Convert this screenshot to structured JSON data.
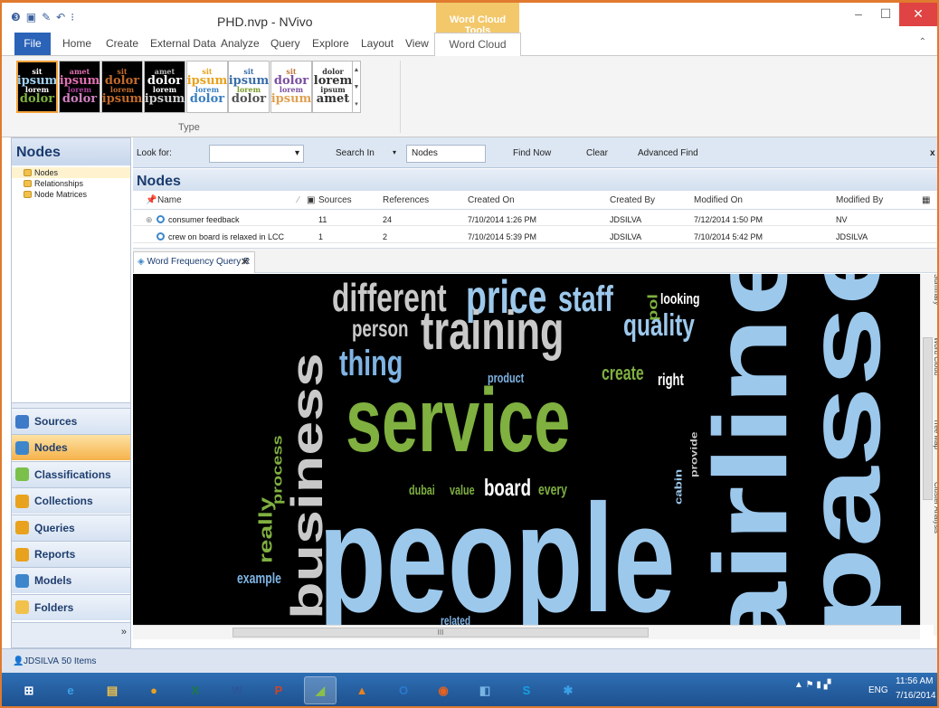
{
  "window": {
    "title": "PHD.nvp - NVivo",
    "context_tab_group": "Word Cloud Tools",
    "controls": {
      "minimize": "–",
      "maximize": "☐",
      "close": "✕"
    }
  },
  "qat_icons": [
    "nvivo-logo-icon",
    "save-icon",
    "edit-icon",
    "undo-icon",
    "customize-icon"
  ],
  "ribbon_tabs": [
    "File",
    "Home",
    "Create",
    "External Data",
    "Analyze",
    "Query",
    "Explore",
    "Layout",
    "View",
    "Word Cloud"
  ],
  "ribbon": {
    "group_label": "Type",
    "thumbs": [
      {
        "bg": "#000000",
        "words": [
          "sit",
          "ipsum",
          "lorem",
          "dolor"
        ],
        "colors": [
          "#ffffff",
          "#9fd0f0",
          "#ffffff",
          "#7fb040"
        ]
      },
      {
        "bg": "#000000",
        "words": [
          "amet",
          "ipsum",
          "lorem",
          "dolor"
        ],
        "colors": [
          "#e06fb0",
          "#e06fb0",
          "#b040a0",
          "#d080c0"
        ]
      },
      {
        "bg": "#000000",
        "words": [
          "sit",
          "dolor",
          "lorem",
          "ipsum"
        ],
        "colors": [
          "#c26a2a",
          "#c26a2a",
          "#c26a2a",
          "#c26a2a"
        ]
      },
      {
        "bg": "#000000",
        "words": [
          "amet",
          "dolor",
          "lorem",
          "ipsum"
        ],
        "colors": [
          "#bbbbbb",
          "#ffffff",
          "#ffffff",
          "#cccccc"
        ]
      },
      {
        "bg": "#ffffff",
        "words": [
          "sit",
          "ipsum",
          "lorem",
          "dolor"
        ],
        "colors": [
          "#e8a21e",
          "#e8a21e",
          "#3a7fc0",
          "#3a7fc0"
        ]
      },
      {
        "bg": "#ffffff",
        "words": [
          "sit",
          "ipsum",
          "lorem",
          "dolor"
        ],
        "colors": [
          "#3a6ea8",
          "#3a6ea8",
          "#7a9a2a",
          "#555555"
        ]
      },
      {
        "bg": "#ffffff",
        "words": [
          "sit",
          "dolor",
          "lorem",
          "ipsum"
        ],
        "colors": [
          "#c07a3a",
          "#7a4fa0",
          "#7a4fa0",
          "#e0a050"
        ]
      },
      {
        "bg": "#ffffff",
        "words": [
          "dolor",
          "lorem",
          "ipsum",
          "amet"
        ],
        "colors": [
          "#333333",
          "#333333",
          "#333333",
          "#333333"
        ]
      }
    ]
  },
  "nav": {
    "header": "Nodes",
    "tree": [
      "Nodes",
      "Relationships",
      "Node Matrices"
    ],
    "buttons": [
      {
        "label": "Sources",
        "icon": "sources-icon",
        "color": "#3d7ac8"
      },
      {
        "label": "Nodes",
        "icon": "nodes-icon",
        "color": "#3d86cc"
      },
      {
        "label": "Classifications",
        "icon": "classifications-icon",
        "color": "#7ac04a"
      },
      {
        "label": "Collections",
        "icon": "collections-icon",
        "color": "#e8a21e"
      },
      {
        "label": "Queries",
        "icon": "queries-icon",
        "color": "#e8a21e"
      },
      {
        "label": "Reports",
        "icon": "reports-icon",
        "color": "#e8a21e"
      },
      {
        "label": "Models",
        "icon": "models-icon",
        "color": "#3d86cc"
      },
      {
        "label": "Folders",
        "icon": "folders-icon",
        "color": "#f1c14b"
      }
    ],
    "footer_glyph": "»"
  },
  "find": {
    "look_for": "Look for:",
    "search_in": "Search In",
    "scope": "Nodes",
    "find_now": "Find Now",
    "clear": "Clear",
    "advanced": "Advanced Find",
    "close": "x"
  },
  "list": {
    "title": "Nodes",
    "columns": [
      "Name",
      "Sources",
      "References",
      "Created On",
      "Created By",
      "Modified On",
      "Modified By"
    ],
    "rows": [
      [
        "consumer feedback",
        "11",
        "24",
        "7/10/2014 1:26 PM",
        "JDSILVA",
        "7/12/2014 1:50 PM",
        "NV"
      ],
      [
        "crew on board is relaxed in LCC",
        "1",
        "2",
        "7/10/2014 5:39 PM",
        "JDSILVA",
        "7/10/2014 5:42 PM",
        "JDSILVA"
      ]
    ]
  },
  "detail": {
    "tab": "Word Frequency Query R",
    "tab_close": "✕"
  },
  "cloud_words": [
    {
      "text": "different",
      "color": "#c9c9c9"
    },
    {
      "text": "price",
      "color": "#9cc8ec"
    },
    {
      "text": "staff",
      "color": "#9cc8ec"
    },
    {
      "text": "pol",
      "color": "#7fb040"
    },
    {
      "text": "looking",
      "color": "#ffffff"
    },
    {
      "text": "person",
      "color": "#c9c9c9"
    },
    {
      "text": "training",
      "color": "#c9c9c9"
    },
    {
      "text": "quality",
      "color": "#9cc8ec"
    },
    {
      "text": "thing",
      "color": "#7fb4e4"
    },
    {
      "text": "business",
      "color": "#c9c9c9"
    },
    {
      "text": "product",
      "color": "#7fb4e4"
    },
    {
      "text": "create",
      "color": "#7fb040"
    },
    {
      "text": "right",
      "color": "#ffffff"
    },
    {
      "text": "service",
      "color": "#7fb040"
    },
    {
      "text": "process",
      "color": "#7fb040"
    },
    {
      "text": "really",
      "color": "#7fb040"
    },
    {
      "text": "dubai",
      "color": "#7fb040"
    },
    {
      "text": "value",
      "color": "#7fb040"
    },
    {
      "text": "board",
      "color": "#ffffff"
    },
    {
      "text": "every",
      "color": "#7fb040"
    },
    {
      "text": "cabin",
      "color": "#9cc8ec"
    },
    {
      "text": "provide",
      "color": "#c9c9c9"
    },
    {
      "text": "people",
      "color": "#9cc8ec"
    },
    {
      "text": "example",
      "color": "#7fb4e4"
    },
    {
      "text": "related",
      "color": "#7fb4e4"
    },
    {
      "text": "airline",
      "color": "#9cc8ec"
    },
    {
      "text": "passengers",
      "color": "#9cc8ec"
    }
  ],
  "right_tabs": [
    "Summary",
    "Word Cloud",
    "Tree Map",
    "Cluster Analysis"
  ],
  "status": {
    "user": "JDSILVA",
    "items": "50 Items"
  },
  "taskbar": {
    "apps": [
      {
        "name": "windows-start-icon",
        "glyph": "⊞",
        "color": "#ffffff"
      },
      {
        "name": "internet-explorer-icon",
        "glyph": "e",
        "color": "#3aa0e8"
      },
      {
        "name": "file-explorer-icon",
        "glyph": "▤",
        "color": "#f1c14b"
      },
      {
        "name": "chrome-icon",
        "glyph": "●",
        "color": "#e8a21e"
      },
      {
        "name": "excel-icon",
        "glyph": "X",
        "color": "#1e7a3e"
      },
      {
        "name": "word-icon",
        "glyph": "W",
        "color": "#2a5699"
      },
      {
        "name": "powerpoint-icon",
        "glyph": "P",
        "color": "#d04525"
      },
      {
        "name": "nvivo-icon",
        "glyph": "◢",
        "color": "#8ac04a"
      },
      {
        "name": "vlc-icon",
        "glyph": "▲",
        "color": "#e8821e"
      },
      {
        "name": "outlook-icon",
        "glyph": "O",
        "color": "#2a7ad0"
      },
      {
        "name": "firefox-icon",
        "glyph": "◉",
        "color": "#e8621e"
      },
      {
        "name": "app-icon",
        "glyph": "◧",
        "color": "#7ab4e4"
      },
      {
        "name": "skype-icon",
        "glyph": "S",
        "color": "#16a0e0"
      },
      {
        "name": "network-app-icon",
        "glyph": "✱",
        "color": "#3aa0e8"
      }
    ],
    "tray": {
      "lang": "ENG",
      "time": "11:56 AM",
      "date": "7/16/2014"
    }
  }
}
